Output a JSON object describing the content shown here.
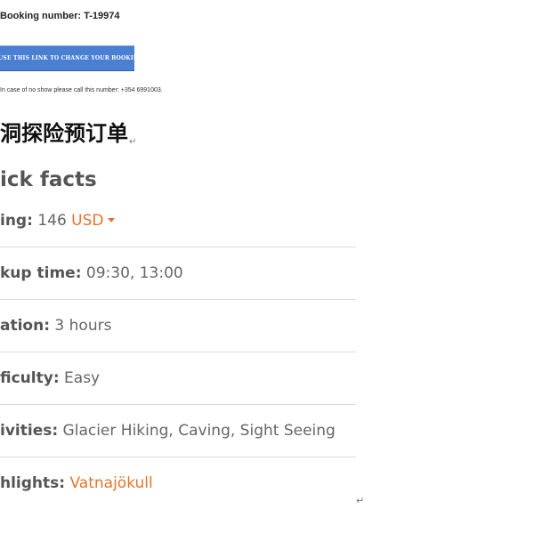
{
  "email": {
    "booking_number": "Booking number: T-19974",
    "change_button_label": "USE THIS LINK TO CHANGE YOUR BOOKING",
    "no_show_note": "In case of no show please call this number: +354 6991003."
  },
  "document": {
    "cn_title": "洞探险预订单",
    "paragraph_mark": "↵"
  },
  "quick_facts": {
    "heading": "ick facts",
    "pricing": {
      "label": "ing:",
      "value": "146",
      "currency": "USD"
    },
    "pickup": {
      "label": "kup time:",
      "value": "09:30, 13:00"
    },
    "duration": {
      "label": "ation:",
      "value": "3 hours"
    },
    "difficulty": {
      "label": "ficulty:",
      "value": "Easy"
    },
    "activities": {
      "label": "ivities:",
      "value": "Glacier Hiking, Caving, Sight Seeing"
    },
    "highlights": {
      "label": "hlights:",
      "value": "Vatnajökull"
    }
  },
  "colors": {
    "accent": "#e4742b",
    "button": "#4a7fd2",
    "text": "#555555",
    "divider": "#dcdcdc"
  }
}
